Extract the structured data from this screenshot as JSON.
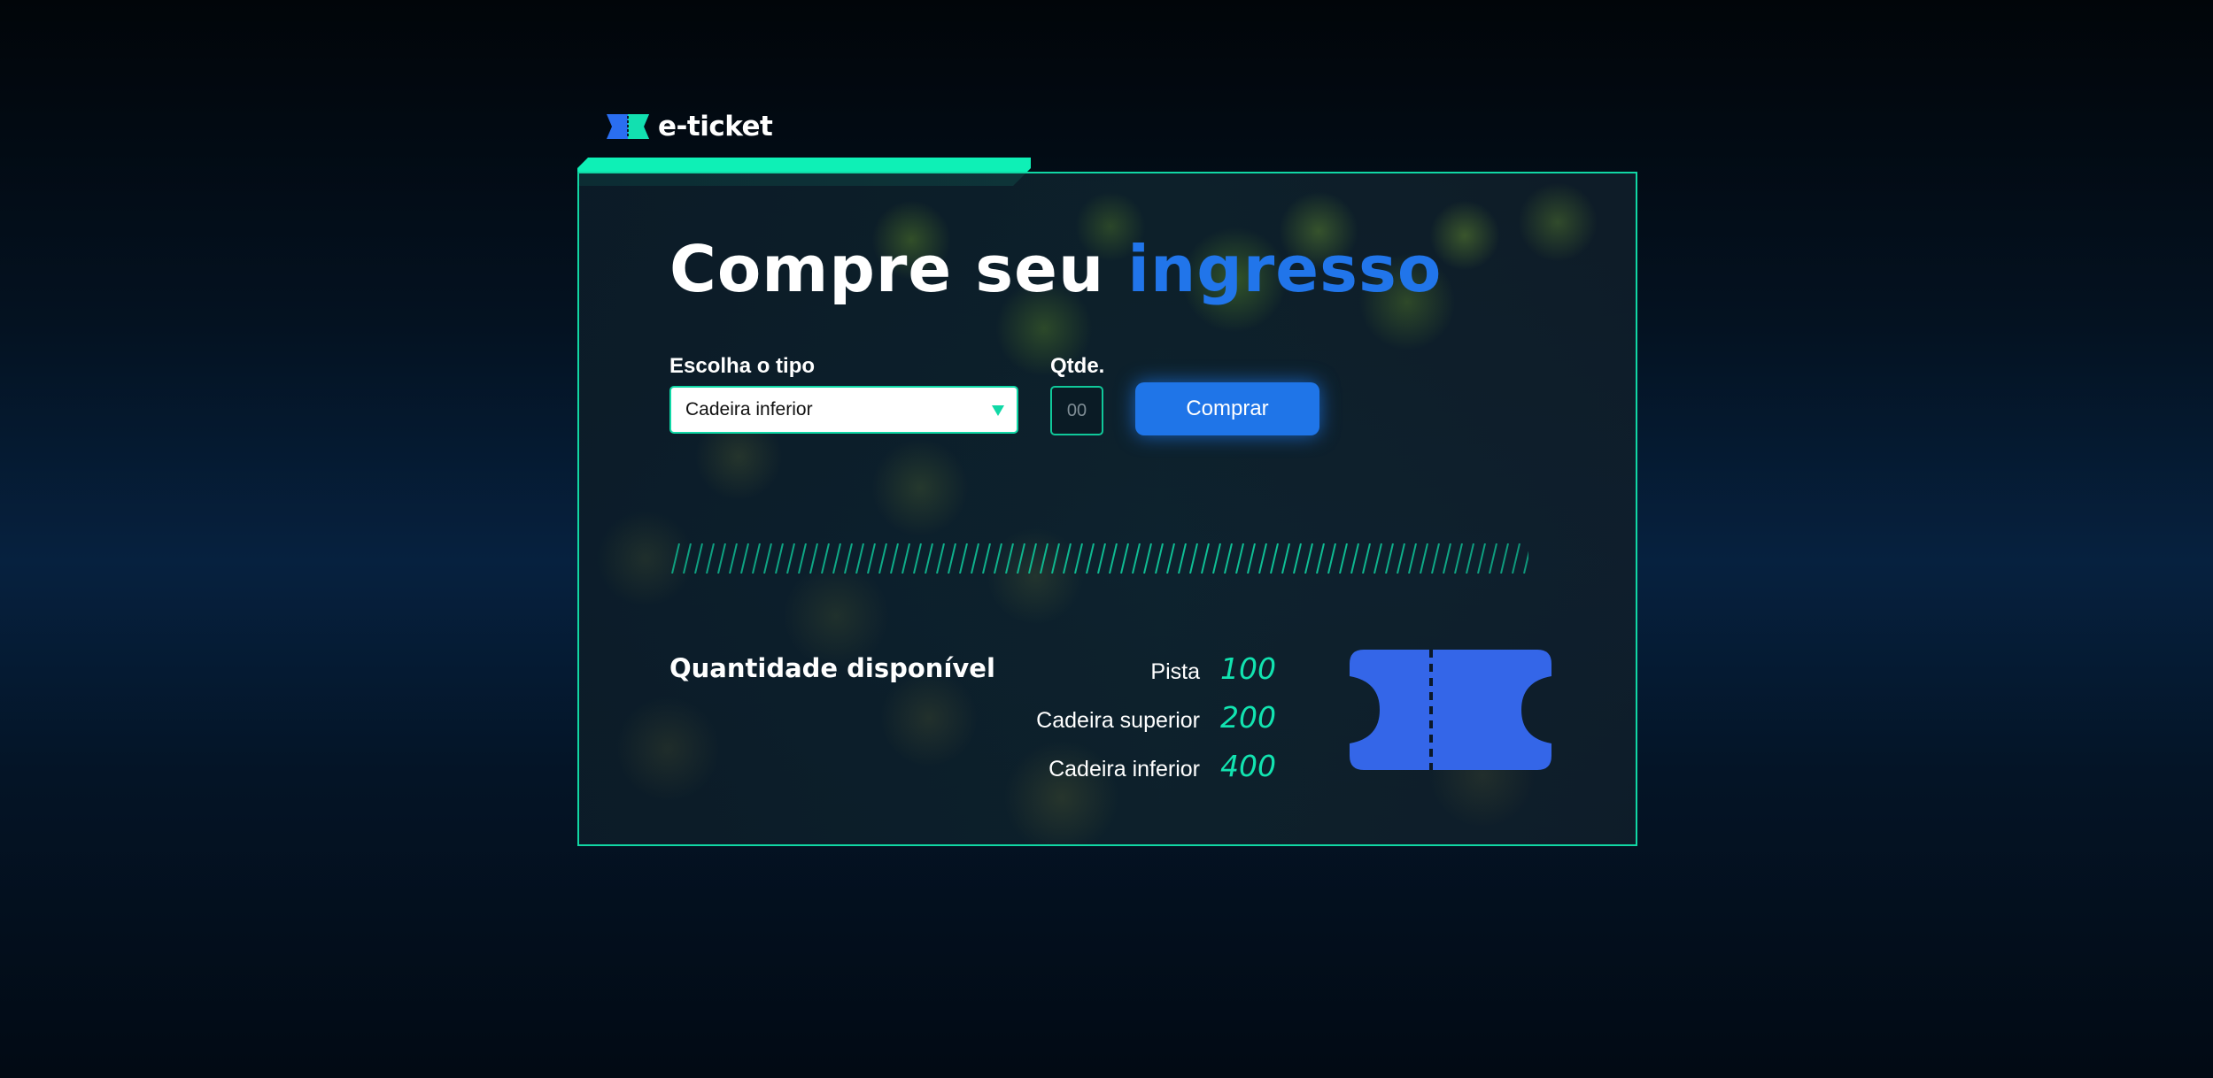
{
  "brand": {
    "name": "e-ticket",
    "accent_color": "#0ef0b6",
    "logo_icon": "ticket-logo-icon"
  },
  "hero": {
    "title_prefix": "Compre seu",
    "title_highlight": "ingresso",
    "highlight_color": "#2175ea"
  },
  "form": {
    "type_label": "Escolha o tipo",
    "type_selected": "Cadeira inferior",
    "quantity_label": "Qtde.",
    "quantity_placeholder": "00",
    "buy_label": "Comprar",
    "buy_color": "#1f75e8"
  },
  "availability": {
    "title": "Quantidade disponível",
    "items": [
      {
        "label": "Pista",
        "value": "100"
      },
      {
        "label": "Cadeira superior",
        "value": "200"
      },
      {
        "label": "Cadeira inferior",
        "value": "400"
      }
    ],
    "value_color": "#12e3b0",
    "illustration_icon": "ticket-icon"
  }
}
